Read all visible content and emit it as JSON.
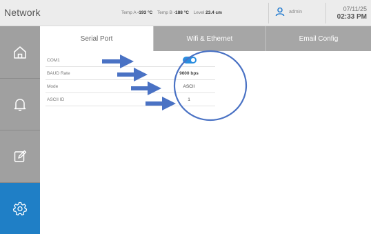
{
  "header": {
    "title": "Network",
    "temp_a_label": "Temp A",
    "temp_a_value": "-193 °C",
    "temp_b_label": "Temp B",
    "temp_b_value": "-188 °C",
    "level_label": "Level",
    "level_value": "23.4 cm",
    "user": "admin",
    "date": "07/11/25",
    "time": "02:33 PM"
  },
  "sidebar": {
    "items": [
      {
        "icon": "home-icon",
        "active": false
      },
      {
        "icon": "bell-icon",
        "active": false
      },
      {
        "icon": "edit-icon",
        "active": false
      },
      {
        "icon": "settings-gear-icon",
        "active": true
      }
    ]
  },
  "tabs": [
    {
      "label": "Serial Port",
      "active": true
    },
    {
      "label": "Wifi & Ethernet",
      "active": false
    },
    {
      "label": "Email Config",
      "active": false
    }
  ],
  "serial": {
    "rows": [
      {
        "label": "COM1",
        "value": "",
        "type": "toggle",
        "on": true
      },
      {
        "label": "BAUD Rate",
        "value": "9600 bps"
      },
      {
        "label": "Mode",
        "value": "ASCII"
      },
      {
        "label": "ASCII ID",
        "value": "1"
      }
    ]
  },
  "colors": {
    "accent": "#1f7fc6",
    "sidebar": "#a0a0a0",
    "tab_inactive": "#a6a6a6",
    "annotation": "#4a72c4"
  }
}
